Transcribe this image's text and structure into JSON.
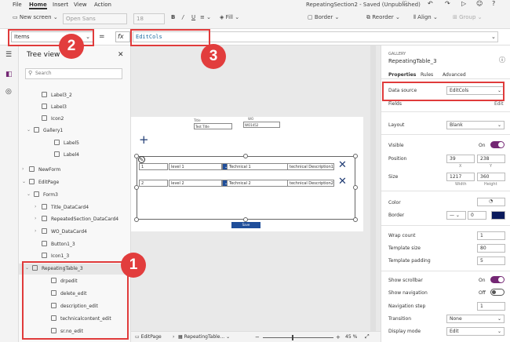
{
  "menu": {
    "items": [
      "File",
      "Home",
      "Insert",
      "View",
      "Action"
    ],
    "active": "Home",
    "doc_title": "RepeatingSection2 - Saved (Unpublished)"
  },
  "toolbar": {
    "new_screen": "New screen",
    "font": "Open Sans",
    "font_size": "18",
    "fill": "Fill",
    "border": "Border",
    "reorder": "Reorder",
    "align": "Align",
    "group": "Group"
  },
  "formula": {
    "property": "Items",
    "equals": "=",
    "fx": "fx",
    "value": "EditCols"
  },
  "badges": {
    "one": "1",
    "two": "2",
    "three": "3"
  },
  "tree": {
    "title": "Tree view",
    "search_placeholder": "Search",
    "items": [
      {
        "label": "Label3_2"
      },
      {
        "label": "Label3"
      },
      {
        "label": "Icon2"
      },
      {
        "label": "Gallery1"
      },
      {
        "label": "Label5"
      },
      {
        "label": "Label4"
      },
      {
        "label": "NewForm"
      },
      {
        "label": "EditPage"
      },
      {
        "label": "Form3"
      },
      {
        "label": "Title_DataCard4"
      },
      {
        "label": "RepeatedSection_DataCard4"
      },
      {
        "label": "WO_DataCard4"
      },
      {
        "label": "Button1_3"
      },
      {
        "label": "Icon1_3"
      },
      {
        "label": "RepeatingTable_3"
      },
      {
        "label": "drpedit"
      },
      {
        "label": "delete_edit"
      },
      {
        "label": "description_edit"
      },
      {
        "label": "technicalcontent_edit"
      },
      {
        "label": "sr.no_edit"
      }
    ]
  },
  "canvas": {
    "title_label": "Title",
    "title_value": "Test Title",
    "wo_label": "WO",
    "wo_value": "WO1452",
    "rows": [
      {
        "no": "1",
        "level": "level 1",
        "tech": "Technical 1",
        "desc": "technical Description1"
      },
      {
        "no": "2",
        "level": "level 2",
        "tech": "Technical 2",
        "desc": "technical Description2"
      }
    ],
    "save_label": "Save"
  },
  "status": {
    "tab1": "EditPage",
    "tab2": "RepeatingTable...",
    "zoom": "45",
    "zoom_unit": "%"
  },
  "props": {
    "kind": "GALLERY",
    "name": "RepeatingTable_3",
    "tabs": [
      "Properties",
      "Rules",
      "Advanced"
    ],
    "data_source_label": "Data source",
    "data_source_value": "EditCols",
    "fields_label": "Fields",
    "fields_edit": "Edit",
    "layout_label": "Layout",
    "layout_value": "Blank",
    "visible_label": "Visible",
    "visible_state": "On",
    "position_label": "Position",
    "pos_x": "39",
    "pos_y": "238",
    "x_caption": "X",
    "y_caption": "Y",
    "size_label": "Size",
    "width": "1217",
    "height": "360",
    "width_caption": "Width",
    "height_caption": "Height",
    "color_label": "Color",
    "border_label": "Border",
    "border_width": "0",
    "wrap_count_label": "Wrap count",
    "wrap_count": "1",
    "template_size_label": "Template size",
    "template_size": "80",
    "template_padding_label": "Template padding",
    "template_padding": "5",
    "show_scrollbar_label": "Show scrollbar",
    "show_scrollbar_state": "On",
    "show_navigation_label": "Show navigation",
    "show_navigation_state": "Off",
    "navigation_step_label": "Navigation step",
    "navigation_step": "1",
    "transition_label": "Transition",
    "transition_value": "None",
    "display_mode_label": "Display mode",
    "display_mode_value": "Edit"
  }
}
